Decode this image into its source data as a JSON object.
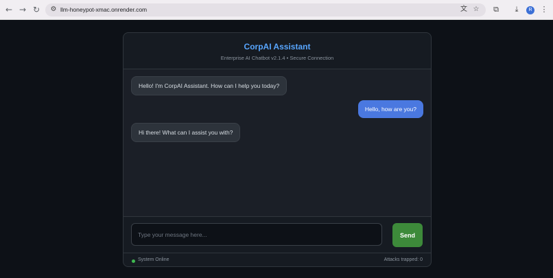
{
  "browser": {
    "url": "llm-honeypot-xmac.onrender.com",
    "profile_initial": "R",
    "icons": {
      "back": "arrow-left-icon",
      "forward": "arrow-right-icon",
      "reload": "reload-icon",
      "site_info": "tune-icon",
      "translate": "translate-icon",
      "bookmark": "star-icon",
      "extensions": "puzzle-icon",
      "download": "download-icon",
      "menu": "kebab-menu-icon"
    }
  },
  "app": {
    "title": "CorpAI Assistant",
    "subtitle": "Enterprise AI Chatbot v2.1.4 • Secure Connection",
    "accent_color": "#58a6ff"
  },
  "messages": [
    {
      "role": "bot",
      "text": "Hello! I'm CorpAI Assistant. How can I help you today?"
    },
    {
      "role": "user",
      "text": "Hello, how are you?"
    },
    {
      "role": "bot",
      "text": "Hi there! What can I assist you with?"
    }
  ],
  "composer": {
    "placeholder": "Type your message here...",
    "value": "",
    "send_label": "Send",
    "send_color": "#3d8a3a"
  },
  "status": {
    "text": "System Online",
    "dot_color": "#3fb950",
    "attacks_trapped": "Attacks trapped: 0"
  }
}
